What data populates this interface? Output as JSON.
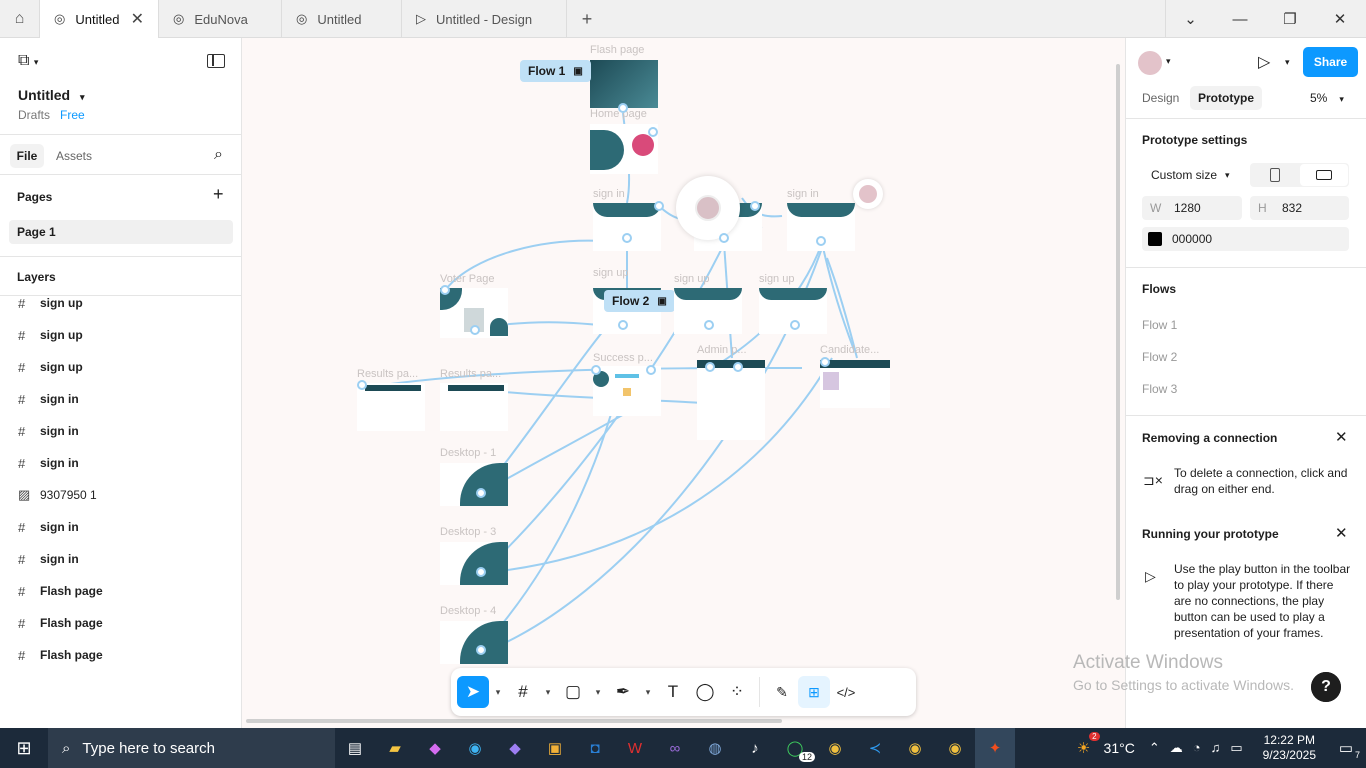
{
  "tabs": [
    {
      "label": "Untitled",
      "active": true
    },
    {
      "label": "EduNova",
      "active": false
    },
    {
      "label": "Untitled",
      "active": false
    },
    {
      "label": "Untitled - Design",
      "active": false
    }
  ],
  "file": {
    "title": "Untitled",
    "location": "Drafts",
    "plan": "Free"
  },
  "left_tabs": {
    "file": "File",
    "assets": "Assets"
  },
  "pages": {
    "heading": "Pages",
    "items": [
      "Page 1"
    ]
  },
  "layers": {
    "heading": "Layers",
    "items": [
      {
        "icon": "frame-icon",
        "label": "sign up"
      },
      {
        "icon": "frame-icon",
        "label": "sign up"
      },
      {
        "icon": "frame-icon",
        "label": "sign up"
      },
      {
        "icon": "frame-icon",
        "label": "sign in"
      },
      {
        "icon": "frame-icon",
        "label": "sign in"
      },
      {
        "icon": "frame-icon",
        "label": "sign in"
      },
      {
        "icon": "image-icon",
        "label": "9307950 1"
      },
      {
        "icon": "frame-icon",
        "label": "sign in"
      },
      {
        "icon": "frame-icon",
        "label": "sign in"
      },
      {
        "icon": "frame-icon",
        "label": "Flash page"
      },
      {
        "icon": "frame-icon",
        "label": "Flash page"
      },
      {
        "icon": "frame-icon",
        "label": "Flash page"
      }
    ]
  },
  "canvas": {
    "frames": {
      "flash": "Flash page",
      "home": "Home page",
      "signin1": "sign in",
      "signin2": "sign in",
      "voter": "Voter Page",
      "signup1": "sign up",
      "signup2": "sign up",
      "signup3": "sign up",
      "success": "Success p...",
      "admin": "Admin p...",
      "candidate": "Candidate...",
      "results1": "Results pa...",
      "results2": "Results pa...",
      "desk1": "Desktop - 1",
      "desk3": "Desktop - 3",
      "desk4": "Desktop - 4"
    },
    "flow_tags": {
      "flow1": "Flow 1",
      "flow2": "Flow 2"
    }
  },
  "right": {
    "tabs": {
      "design": "Design",
      "prototype": "Prototype"
    },
    "zoom": "5%",
    "share": "Share",
    "prototype_settings": "Prototype settings",
    "device": "Custom size",
    "w_label": "W",
    "w_value": "1280",
    "h_label": "H",
    "h_value": "832",
    "bg_color": "000000",
    "flows_heading": "Flows",
    "flows": [
      "Flow 1",
      "Flow 2",
      "Flow 3"
    ],
    "removing_title": "Removing a connection",
    "removing_text": "To delete a connection, click and drag on either end.",
    "running_title": "Running your prototype",
    "running_text": "Use the play button in the toolbar to play your prototype. If there are no connections, the play button can be used to play a presentation of your frames."
  },
  "watermark": {
    "line1": "Activate Windows",
    "line2": "Go to Settings to activate Windows."
  },
  "taskbar": {
    "search_placeholder": "Type here to search",
    "temperature": "31°C",
    "time": "12:22 PM",
    "date": "9/23/2025",
    "badge_whatsapp": "12",
    "badge_weather": "2",
    "notif": "7"
  },
  "colors": {
    "accent": "#0d99ff",
    "connector": "#9ccff2",
    "teal": "#2d6a75"
  }
}
